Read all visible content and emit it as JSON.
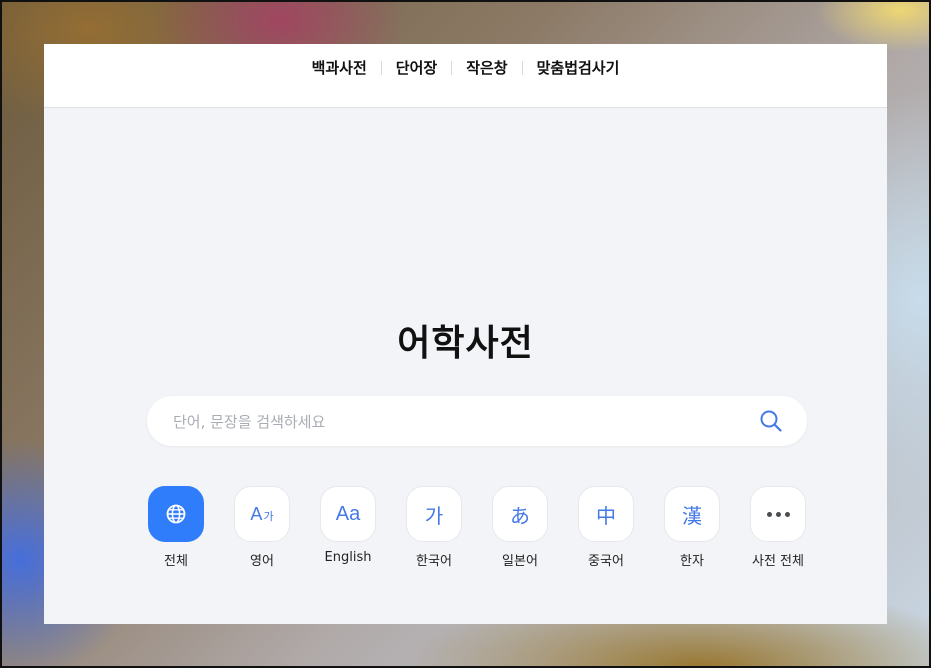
{
  "nav": {
    "items": [
      "백과사전",
      "단어장",
      "작은창",
      "맞춤법검사기"
    ]
  },
  "main": {
    "title": "어학사전"
  },
  "search": {
    "placeholder": "단어, 문장을 검색하세요",
    "value": "",
    "icon": "search-icon"
  },
  "categories": [
    {
      "label": "전체",
      "icon": "globe-icon",
      "glyph": "",
      "active": true
    },
    {
      "label": "영어",
      "icon": "a-ga-icon",
      "glyph": "A가",
      "active": false
    },
    {
      "label": "English",
      "icon": "aa-icon",
      "glyph": "Aa",
      "active": false
    },
    {
      "label": "한국어",
      "icon": "ga-icon",
      "glyph": "가",
      "active": false
    },
    {
      "label": "일본어",
      "icon": "hiragana-a-icon",
      "glyph": "あ",
      "active": false
    },
    {
      "label": "중국어",
      "icon": "zhong-icon",
      "glyph": "中",
      "active": false
    },
    {
      "label": "한자",
      "icon": "han-icon",
      "glyph": "漢",
      "active": false
    },
    {
      "label": "사전 전체",
      "icon": "more-icon",
      "glyph": "",
      "active": false
    }
  ],
  "colors": {
    "accent": "#2f7dfb",
    "icon_blue": "#4479e8",
    "panel_bg": "#f2f4f7"
  }
}
